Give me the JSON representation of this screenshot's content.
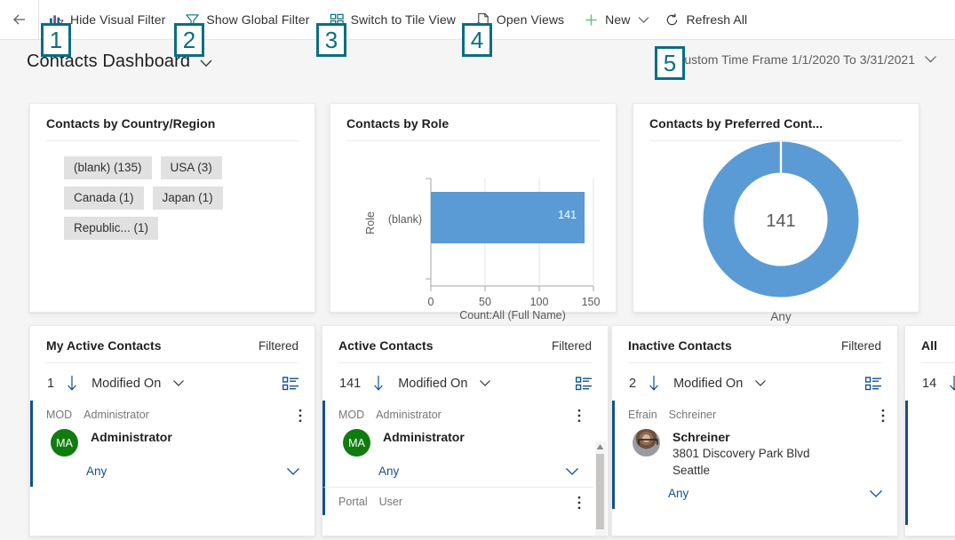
{
  "commandbar": {
    "back_label": "Back",
    "items": [
      {
        "id": "hide-visual-filter",
        "label": "Hide Visual Filter",
        "icon": "chart-filter-icon"
      },
      {
        "id": "show-global-filter",
        "label": "Show Global Filter",
        "icon": "funnel-icon"
      },
      {
        "id": "switch-to-tile-view",
        "label": "Switch to Tile View",
        "icon": "tile-view-icon"
      },
      {
        "id": "open-views",
        "label": "Open Views",
        "icon": "page-views-icon"
      },
      {
        "id": "new",
        "label": "New",
        "icon": "plus-icon"
      },
      {
        "id": "refresh-all",
        "label": "Refresh All",
        "icon": "refresh-icon"
      }
    ]
  },
  "header": {
    "title": "Contacts Dashboard",
    "timeframe": "Custom Time Frame 1/1/2020 To 3/31/2021"
  },
  "badges": [
    "1",
    "2",
    "3",
    "4",
    "5"
  ],
  "colors": {
    "badge_teal": "#0a6e82",
    "chart_blue": "#5b9bd5",
    "accent_blue": "#12508f",
    "avatar_green": "#107c10",
    "tag_gray": "#e1e1e1"
  },
  "cards": {
    "country": {
      "title": "Contacts by Country/Region",
      "tags": [
        "(blank) (135)",
        "USA (3)",
        "Canada (1)",
        "Japan (1)",
        "Republic... (1)"
      ]
    },
    "role": {
      "title": "Contacts by Role"
    },
    "preferred": {
      "title": "Contacts by Preferred Cont..."
    }
  },
  "chart_data": [
    {
      "type": "bar",
      "orientation": "horizontal",
      "title": "Contacts by Role",
      "categories": [
        "(blank)"
      ],
      "values": [
        141
      ],
      "data_labels": [
        "141"
      ],
      "xlabel": "Count:All (Full Name)",
      "ylabel": "Role",
      "xlim": [
        0,
        150
      ],
      "xticks": [
        0,
        50,
        100,
        150
      ],
      "xticklabels": [
        "0",
        "50",
        "100",
        "150"
      ],
      "grid": true,
      "legend": "none",
      "series_color": "#5b9bd5"
    },
    {
      "type": "pie",
      "variant": "donut",
      "title": "Contacts by Preferred Cont...",
      "categories": [
        "Any"
      ],
      "values": [
        141
      ],
      "center_label": "141",
      "legend": "bottom",
      "legend_entries": [
        "Any"
      ],
      "series_color": "#5b9bd5"
    },
    {
      "type": "bar",
      "variant": "tag-list",
      "title": "Contacts by Country/Region",
      "categories": [
        "(blank)",
        "USA",
        "Canada",
        "Japan",
        "Republic..."
      ],
      "values": [
        135,
        3,
        1,
        1,
        1
      ],
      "labels": [
        "(blank) (135)",
        "USA (3)",
        "Canada (1)",
        "Japan (1)",
        "Republic... (1)"
      ]
    }
  ],
  "lists": [
    {
      "title": "My Active Contacts",
      "filtered": "Filtered",
      "count": "1",
      "sort_field": "Modified On",
      "records": [
        {
          "meta_left": "MOD",
          "meta_right": "Administrator",
          "avatar_type": "initials",
          "avatar_initials": "MA",
          "name": "Administrator",
          "lines": [],
          "footer": "Any"
        }
      ]
    },
    {
      "title": "Active Contacts",
      "filtered": "Filtered",
      "count": "141",
      "sort_field": "Modified On",
      "records": [
        {
          "meta_left": "MOD",
          "meta_right": "Administrator",
          "avatar_type": "initials",
          "avatar_initials": "MA",
          "name": "Administrator",
          "lines": [],
          "footer": "Any"
        },
        {
          "meta_left": "Portal",
          "meta_right": "User",
          "avatar_type": "none",
          "avatar_initials": "",
          "name": "",
          "lines": [],
          "footer": ""
        }
      ]
    },
    {
      "title": "Inactive Contacts",
      "filtered": "Filtered",
      "count": "2",
      "sort_field": "Modified On",
      "records": [
        {
          "meta_left": "Efrain",
          "meta_right": "Schreiner",
          "avatar_type": "photo",
          "avatar_initials": "",
          "name": "Schreiner",
          "lines": [
            "3801 Discovery Park Blvd",
            "Seattle"
          ],
          "footer": "Any"
        }
      ]
    },
    {
      "title": "All",
      "filtered": "",
      "count": "14",
      "sort_field": "",
      "records": []
    }
  ]
}
